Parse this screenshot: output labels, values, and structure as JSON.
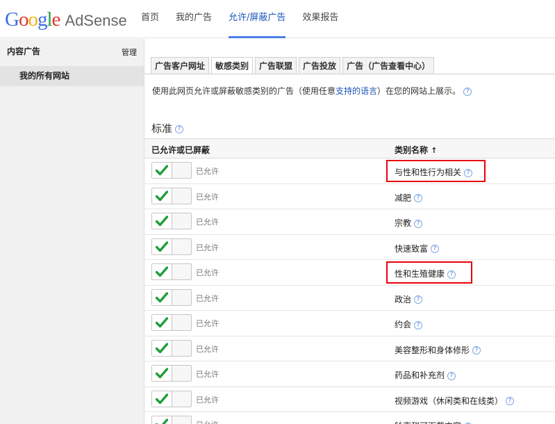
{
  "header": {
    "logo_google": "Google",
    "logo_product": "AdSense",
    "nav": [
      "首页",
      "我的广告",
      "允许/屏蔽广告",
      "效果报告"
    ],
    "active_nav_index": 2
  },
  "sidebar": {
    "section_title": "内容广告",
    "manage_label": "管理",
    "site_item": "我的所有网站"
  },
  "tabs": [
    "广告客户网址",
    "敏感类别",
    "广告联盟",
    "广告投放",
    "广告（广告查看中心）"
  ],
  "active_tab_index": 1,
  "description": {
    "before": "使用此网页允许或屏蔽敏感类别的广告（使用任意",
    "link": "支持的语言",
    "after": "）在您的网站上展示。"
  },
  "section_title": "标准",
  "table": {
    "col_status": "已允许或已屏蔽",
    "col_category": "类别名称",
    "sort_arrow": "↑",
    "rows": [
      {
        "status": "已允许",
        "category": "与性和性行为相关",
        "highlighted": true
      },
      {
        "status": "已允许",
        "category": "减肥",
        "highlighted": false
      },
      {
        "status": "已允许",
        "category": "宗教",
        "highlighted": false
      },
      {
        "status": "已允许",
        "category": "快速致富",
        "highlighted": false
      },
      {
        "status": "已允许",
        "category": "性和生殖健康",
        "highlighted": true
      },
      {
        "status": "已允许",
        "category": "政治",
        "highlighted": false
      },
      {
        "status": "已允许",
        "category": "约会",
        "highlighted": false
      },
      {
        "status": "已允许",
        "category": "美容整形和身体修形",
        "highlighted": false
      },
      {
        "status": "已允许",
        "category": "药品和补充剂",
        "highlighted": false
      },
      {
        "status": "已允许",
        "category": "视频游戏（休闲类和在线类）",
        "highlighted": false
      },
      {
        "status": "已允许",
        "category": "铃声和可下载内容",
        "highlighted": false
      }
    ]
  },
  "colors": {
    "accent": "#1a55b8",
    "check": "#1f9e3a",
    "highlight": "#e8000b"
  }
}
